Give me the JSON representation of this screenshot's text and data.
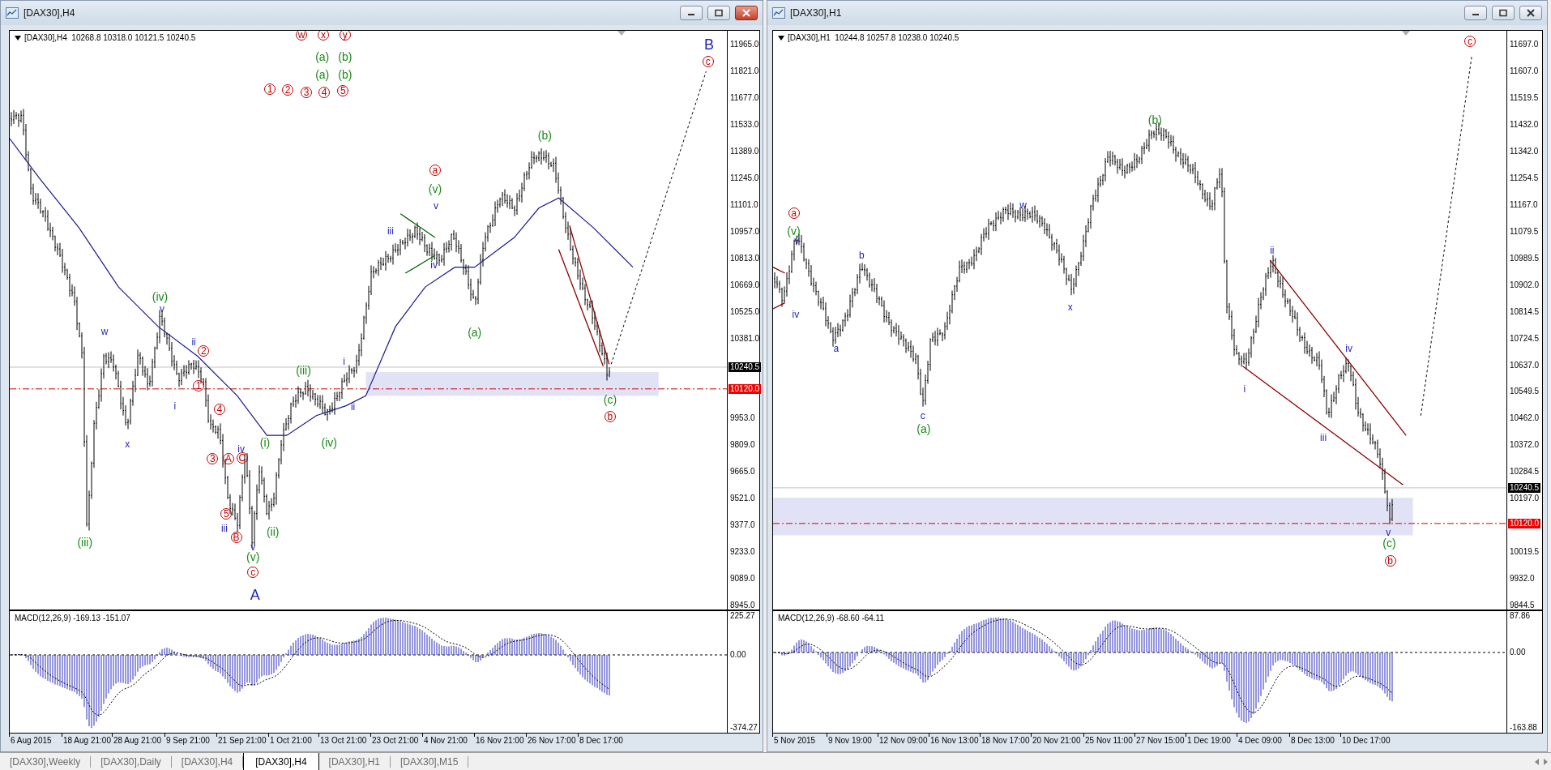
{
  "windows": [
    {
      "title": "[DAX30],H4",
      "active": true,
      "chart": {
        "header": "[DAX30],H4  10268.8 10318.0 10121.5 10240.5",
        "price_axis": [
          "11965.0",
          "11821.0",
          "11677.0",
          "11533.0",
          "11389.0",
          "11245.0",
          "11101.0",
          "10957.0",
          "10813.0",
          "10669.0",
          "10525.0",
          "10381.0",
          "9953.0",
          "9809.0",
          "9665.0",
          "9521.0",
          "9377.0",
          "9233.0",
          "9089.0",
          "8945.0"
        ],
        "current_price": "10240.5",
        "level_price": "10120.0",
        "indicator": {
          "label": "MACD(12,26,9) -169.13 -151.07",
          "axis": [
            "225.27",
            "0.00",
            "-374.27"
          ]
        },
        "time_axis": [
          "6 Aug 2015",
          "18 Aug 21:00",
          "28 Aug 21:00",
          "9 Sep 21:00",
          "21 Sep 21:00",
          "1 Oct 21:00",
          "13 Oct 21:00",
          "23 Oct 21:00",
          "4 Nov 21:00",
          "16 Nov 21:00",
          "26 Nov 17:00",
          "8 Dec 17:00"
        ],
        "wave_labels": [
          {
            "text": "w",
            "kind": "circled"
          },
          {
            "text": "x",
            "kind": "circled"
          },
          {
            "text": "y",
            "kind": "circled"
          },
          {
            "text": "(a)",
            "kind": "paren"
          },
          {
            "text": "(b)",
            "kind": "paren"
          },
          {
            "text": "(a)",
            "kind": "paren"
          },
          {
            "text": "(b)",
            "kind": "paren"
          },
          {
            "text": "1",
            "kind": "circled"
          },
          {
            "text": "2",
            "kind": "circled"
          },
          {
            "text": "3",
            "kind": "circled"
          },
          {
            "text": "4",
            "kind": "circled"
          },
          {
            "text": "5",
            "kind": "circled"
          },
          {
            "text": "B",
            "kind": "major"
          },
          {
            "text": "c",
            "kind": "circled"
          },
          {
            "text": "a",
            "kind": "circled"
          },
          {
            "text": "(v)",
            "kind": "paren"
          },
          {
            "text": "v",
            "kind": "minor"
          },
          {
            "text": "(b)",
            "kind": "paren"
          },
          {
            "text": "iii",
            "kind": "minor"
          },
          {
            "text": "iv",
            "kind": "minor"
          },
          {
            "text": "(a)",
            "kind": "paren"
          },
          {
            "text": "(iv)",
            "kind": "paren"
          },
          {
            "text": "v",
            "kind": "minor"
          },
          {
            "text": "w",
            "kind": "minor"
          },
          {
            "text": "ii",
            "kind": "minor"
          },
          {
            "text": "2",
            "kind": "circled"
          },
          {
            "text": "1",
            "kind": "circled"
          },
          {
            "text": "i",
            "kind": "minor"
          },
          {
            "text": "x",
            "kind": "minor"
          },
          {
            "text": "(iii)",
            "kind": "paren"
          },
          {
            "text": "i",
            "kind": "minor"
          },
          {
            "text": "ii",
            "kind": "minor"
          },
          {
            "text": "(iv)",
            "kind": "paren"
          },
          {
            "text": "4",
            "kind": "circled"
          },
          {
            "text": "iv",
            "kind": "minor"
          },
          {
            "text": "3",
            "kind": "circled"
          },
          {
            "text": "A",
            "kind": "circled"
          },
          {
            "text": "C",
            "kind": "circled"
          },
          {
            "text": "(i)",
            "kind": "paren"
          },
          {
            "text": "5",
            "kind": "circled"
          },
          {
            "text": "iii",
            "kind": "minor"
          },
          {
            "text": "B",
            "kind": "circled"
          },
          {
            "text": "(ii)",
            "kind": "paren"
          },
          {
            "text": "v",
            "kind": "minor"
          },
          {
            "text": "(v)",
            "kind": "paren"
          },
          {
            "text": "c",
            "kind": "circled"
          },
          {
            "text": "A",
            "kind": "major"
          },
          {
            "text": "(iii)",
            "kind": "paren"
          },
          {
            "text": "(c)",
            "kind": "paren"
          },
          {
            "text": "b",
            "kind": "circled"
          }
        ]
      }
    },
    {
      "title": "[DAX30],H1",
      "active": false,
      "chart": {
        "header": "[DAX30],H1  10244.8 10257.8 10238.0 10240.5",
        "price_axis": [
          "11697.0",
          "11607.0",
          "11519.5",
          "11432.0",
          "11342.0",
          "11254.5",
          "11167.0",
          "11079.5",
          "10989.5",
          "10902.0",
          "10814.5",
          "10724.5",
          "10637.0",
          "10549.5",
          "10462.0",
          "10372.0",
          "10284.5",
          "10197.0",
          "10019.5",
          "9932.0",
          "9844.5"
        ],
        "current_price": "10240.5",
        "level_price": "10120.0",
        "indicator": {
          "label": "MACD(12,26,9) -68.60 -64.11",
          "axis": [
            "87.86",
            "0.00",
            "-163.88"
          ]
        },
        "time_axis": [
          "5 Nov 2015",
          "9 Nov 19:00",
          "12 Nov 09:00",
          "16 Nov 13:00",
          "18 Nov 17:00",
          "20 Nov 21:00",
          "25 Nov 11:00",
          "27 Nov 15:00",
          "1 Dec 19:00",
          "4 Dec 09:00",
          "8 Dec 13:00",
          "10 Dec 17:00"
        ],
        "wave_labels": [
          {
            "text": "c",
            "kind": "circled"
          },
          {
            "text": "a",
            "kind": "circled"
          },
          {
            "text": "(v)",
            "kind": "paren"
          },
          {
            "text": "v",
            "kind": "minor"
          },
          {
            "text": "iv",
            "kind": "minor"
          },
          {
            "text": "a",
            "kind": "minor"
          },
          {
            "text": "b",
            "kind": "minor"
          },
          {
            "text": "c",
            "kind": "minor"
          },
          {
            "text": "(a)",
            "kind": "paren"
          },
          {
            "text": "w",
            "kind": "minor"
          },
          {
            "text": "x",
            "kind": "minor"
          },
          {
            "text": "(b)",
            "kind": "paren"
          },
          {
            "text": "ii",
            "kind": "minor"
          },
          {
            "text": "i",
            "kind": "minor"
          },
          {
            "text": "iv",
            "kind": "minor"
          },
          {
            "text": "iii",
            "kind": "minor"
          },
          {
            "text": "v",
            "kind": "minor"
          },
          {
            "text": "(c)",
            "kind": "paren"
          },
          {
            "text": "b",
            "kind": "circled"
          }
        ]
      }
    }
  ],
  "tabs": [
    {
      "label": "[DAX30],Weekly",
      "selected": false
    },
    {
      "label": "[DAX30],Daily",
      "selected": false
    },
    {
      "label": "[DAX30],H4",
      "selected": false
    },
    {
      "label": "[DAX30],H4",
      "selected": true
    },
    {
      "label": "[DAX30],H1",
      "selected": false
    },
    {
      "label": "[DAX30],M15",
      "selected": false
    }
  ]
}
